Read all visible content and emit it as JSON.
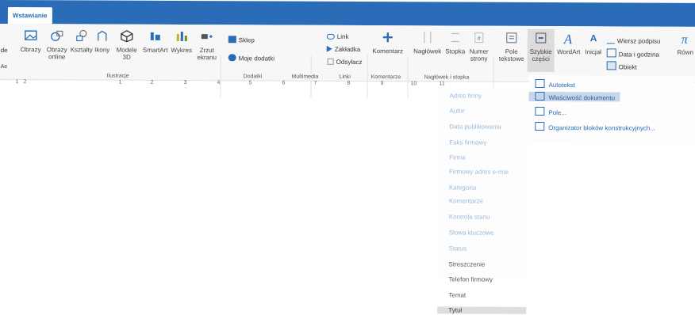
{
  "tab": {
    "label": "Wstawianie"
  },
  "ribbon": {
    "left_partial": "de",
    "left_partial2": "Ae",
    "items": {
      "obrazy": "Obrazy",
      "obrazy_online_1": "Obrazy",
      "obrazy_online_2": "online",
      "ksztalty": "Kształty",
      "ikony": "Ikony",
      "modele3d_1": "Modele",
      "modele3d_2": "3D",
      "smartart": "SmartArt",
      "wykres": "Wykres",
      "zrzut_1": "Zrzut",
      "zrzut_2": "ekranu",
      "sklep": "Sklep",
      "moje_dodatki": "Moje dodatki",
      "link": "Link",
      "zakladka": "Zakładka",
      "odsylacz": "Odsyłacz",
      "komentarz": "Komentarz",
      "naglowek": "Nagłówek",
      "stopka": "Stopka",
      "numer_1": "Numer",
      "numer_2": "strony",
      "pole_1": "Pole",
      "pole_2": "tekstowe",
      "szybkie_1": "Szybkie",
      "szybkie_2": "części",
      "wordart": "WordArt",
      "inicjal": "Inicjał",
      "wiersz_podpisu": "Wiersz podpisu",
      "data_godzina": "Data i godzina",
      "obiekt": "Obiekt",
      "rownanie": "Równ"
    },
    "groups": {
      "ilustracje": "Ilustracje",
      "dodatki": "Dodatki",
      "multimedia": "Multimedia",
      "linki": "Linki",
      "komentarze": "Komentarze",
      "naglowek_stopka": "Nagłówek i stopka"
    }
  },
  "ruler": {
    "marks": [
      "1",
      "2",
      "1",
      "2",
      "3",
      "4",
      "5",
      "6",
      "7",
      "8",
      "9",
      "10",
      "11"
    ]
  },
  "dropdown": {
    "items": [
      {
        "label": "Adres firmy",
        "style": "faint"
      },
      {
        "label": "Autor",
        "style": "faint"
      },
      {
        "label": "Data publikowania",
        "style": "faint"
      },
      {
        "label": "Faks firmowy",
        "style": "faint"
      },
      {
        "label": "Firma",
        "style": "faint"
      },
      {
        "label": "Firmowy adres e-mai",
        "style": "faint"
      },
      {
        "label": "Kategoria",
        "style": "faint"
      },
      {
        "label": "Komentarze",
        "style": "faint"
      },
      {
        "label": "Kontrola stanu",
        "style": "faint"
      },
      {
        "label": "Słowa kluczowe",
        "style": "faint"
      },
      {
        "label": "Status",
        "style": "faint"
      },
      {
        "label": "Streszczenie",
        "style": "dark"
      },
      {
        "label": "Telefon firmowy",
        "style": "dark"
      },
      {
        "label": "Temat",
        "style": "dark"
      },
      {
        "label": "Tytuł",
        "style": "sel"
      }
    ]
  },
  "submenu": {
    "items": [
      {
        "label": "Autotekst",
        "icon": "autotext-icon"
      },
      {
        "label": "Właściwość dokumentu",
        "icon": "document-property-icon",
        "highlight": true
      },
      {
        "label": "Pole...",
        "icon": "field-icon"
      },
      {
        "label": "Organizator bloków konstrukcyjnych...",
        "icon": "building-blocks-icon"
      }
    ]
  },
  "colors": {
    "accent": "#2b6cb8",
    "tab_bg": "#ffffff",
    "ribbon_bg": "#f7f7f7",
    "highlight": "#c7d7ea"
  }
}
